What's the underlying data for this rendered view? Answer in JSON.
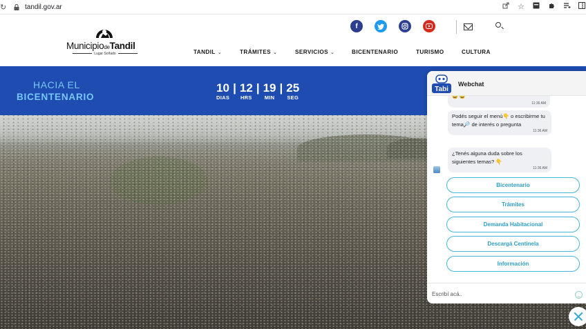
{
  "browser": {
    "url": "tandil.gov.ar"
  },
  "header": {
    "logo": {
      "name_part1": "Municipio",
      "name_part2": "de",
      "name_part3": "Tandil",
      "tagline": "Lugar Soñado"
    },
    "nav": [
      {
        "label": "TANDIL",
        "has_dropdown": true
      },
      {
        "label": "TRÁMITES",
        "has_dropdown": true
      },
      {
        "label": "SERVICIOS",
        "has_dropdown": true
      },
      {
        "label": "BICENTENARIO",
        "has_dropdown": false
      },
      {
        "label": "TURISMO",
        "has_dropdown": false
      },
      {
        "label": "CULTURA",
        "has_dropdown": false
      }
    ],
    "social": [
      "facebook-icon",
      "twitter-icon",
      "instagram-icon",
      "youtube-icon"
    ]
  },
  "banner": {
    "line1": "HACIA EL",
    "line2": "BICENTENARIO",
    "countdown": [
      {
        "value": "10",
        "label": "DIAS"
      },
      {
        "value": "12",
        "label": "HRS"
      },
      {
        "value": "19",
        "label": "MIN"
      },
      {
        "value": "25",
        "label": "SEG"
      }
    ],
    "separator": "|"
  },
  "webchat": {
    "title": "Webchat",
    "bot_name": "Tabi",
    "messages": [
      {
        "text": "Podés seguir el menú👇 o escribirme tu tema🔎 de interés o pregunta",
        "time": "11:36 AM"
      },
      {
        "text": "¿Tenés alguna duda sobre los siguientes temas? 👇",
        "time": "11:36 AM"
      }
    ],
    "partial_time": "11:36 AM",
    "quick_replies": [
      "Bicentenario",
      "Trámites",
      "Demanda Habitacional",
      "Descargá Centinela",
      "Información"
    ],
    "input_placeholder": "Escribí acá.."
  },
  "colors": {
    "banner_blue": "#1e4cb0",
    "banner_text": "#79c7ff",
    "chat_accent": "#42b8d6"
  }
}
